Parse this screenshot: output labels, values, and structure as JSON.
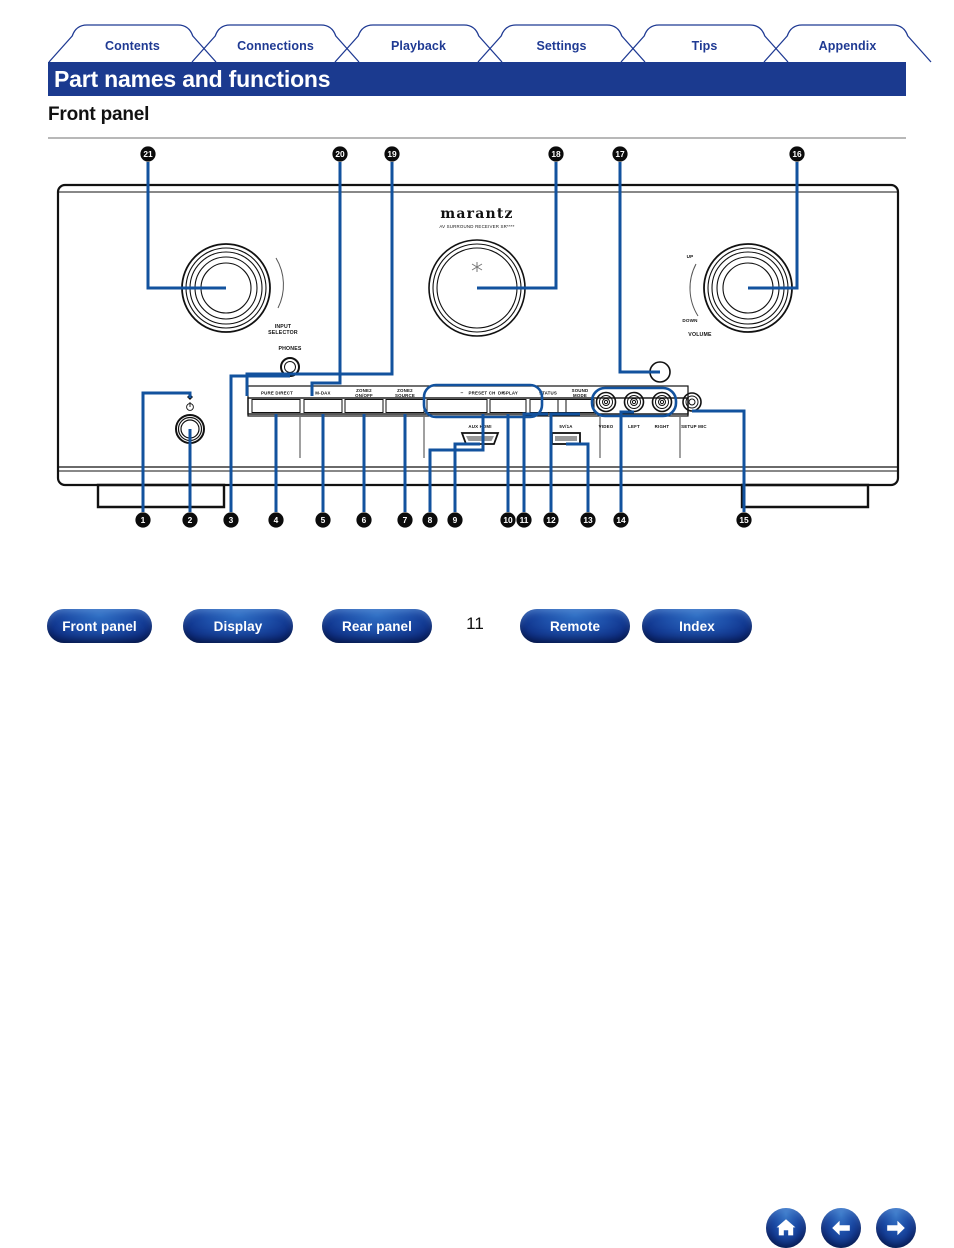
{
  "document": {
    "title": "Part names and functions",
    "section_heading": "Front panel",
    "page_number": "11"
  },
  "colors": {
    "brand_blue": "#1b3a8f",
    "tab_text": "#1f3a93",
    "callout_line": "#12529e",
    "title_bar_bg": "#1b3a8f",
    "rule_gray": "#b8b8b8"
  },
  "tabs": [
    {
      "label": "Contents"
    },
    {
      "label": "Connections"
    },
    {
      "label": "Playback"
    },
    {
      "label": "Settings"
    },
    {
      "label": "Tips"
    },
    {
      "label": "Appendix"
    }
  ],
  "bottom_nav": {
    "buttons": [
      {
        "label": "Front panel"
      },
      {
        "label": "Display"
      },
      {
        "label": "Rear panel"
      },
      {
        "label": "Remote"
      },
      {
        "label": "Index"
      }
    ],
    "icons": [
      {
        "name": "home-icon"
      },
      {
        "name": "arrow-left-icon"
      },
      {
        "name": "arrow-right-icon"
      }
    ]
  },
  "figure": {
    "brand": "marantz",
    "model_text": "AV SURROUND RECEIVER SR****",
    "knob_labels": {
      "input_selector": "INPUT\nSELECTOR",
      "input_selector_line1": "INPUT",
      "input_selector_line2": "SELECTOR",
      "volume": "VOLUME",
      "volume_up": "UP",
      "volume_down": "DOWN"
    },
    "jack_labels": {
      "phones": "PHONES",
      "video": "VIDEO",
      "left": "LEFT",
      "right": "RIGHT",
      "setup_mic": "SETUP MIC",
      "aux_hdmi": "AUX HDMI",
      "usb_power": "5V/1A"
    },
    "buttons": [
      {
        "line1": "PURE DIRECT",
        "line2": ""
      },
      {
        "line1": "M-DAX",
        "line2": ""
      },
      {
        "line1": "ZONE2",
        "line2": "ON/OFF"
      },
      {
        "line1": "ZONE2",
        "line2": "SOURCE"
      },
      {
        "line1": "DISPLAY",
        "line2": ""
      },
      {
        "line1": "STATUS",
        "line2": ""
      },
      {
        "line1": "SOUND",
        "line2": "MODE"
      }
    ],
    "preset_label": "PRESET CH",
    "preset_minus": "−",
    "preset_plus": "+",
    "callouts_top": [
      "21",
      "20",
      "19",
      "18",
      "17",
      "16"
    ],
    "callouts_bottom": [
      "1",
      "2",
      "3",
      "4",
      "5",
      "6",
      "7",
      "8",
      "9",
      "10",
      "11",
      "12",
      "13",
      "14",
      "15"
    ]
  }
}
